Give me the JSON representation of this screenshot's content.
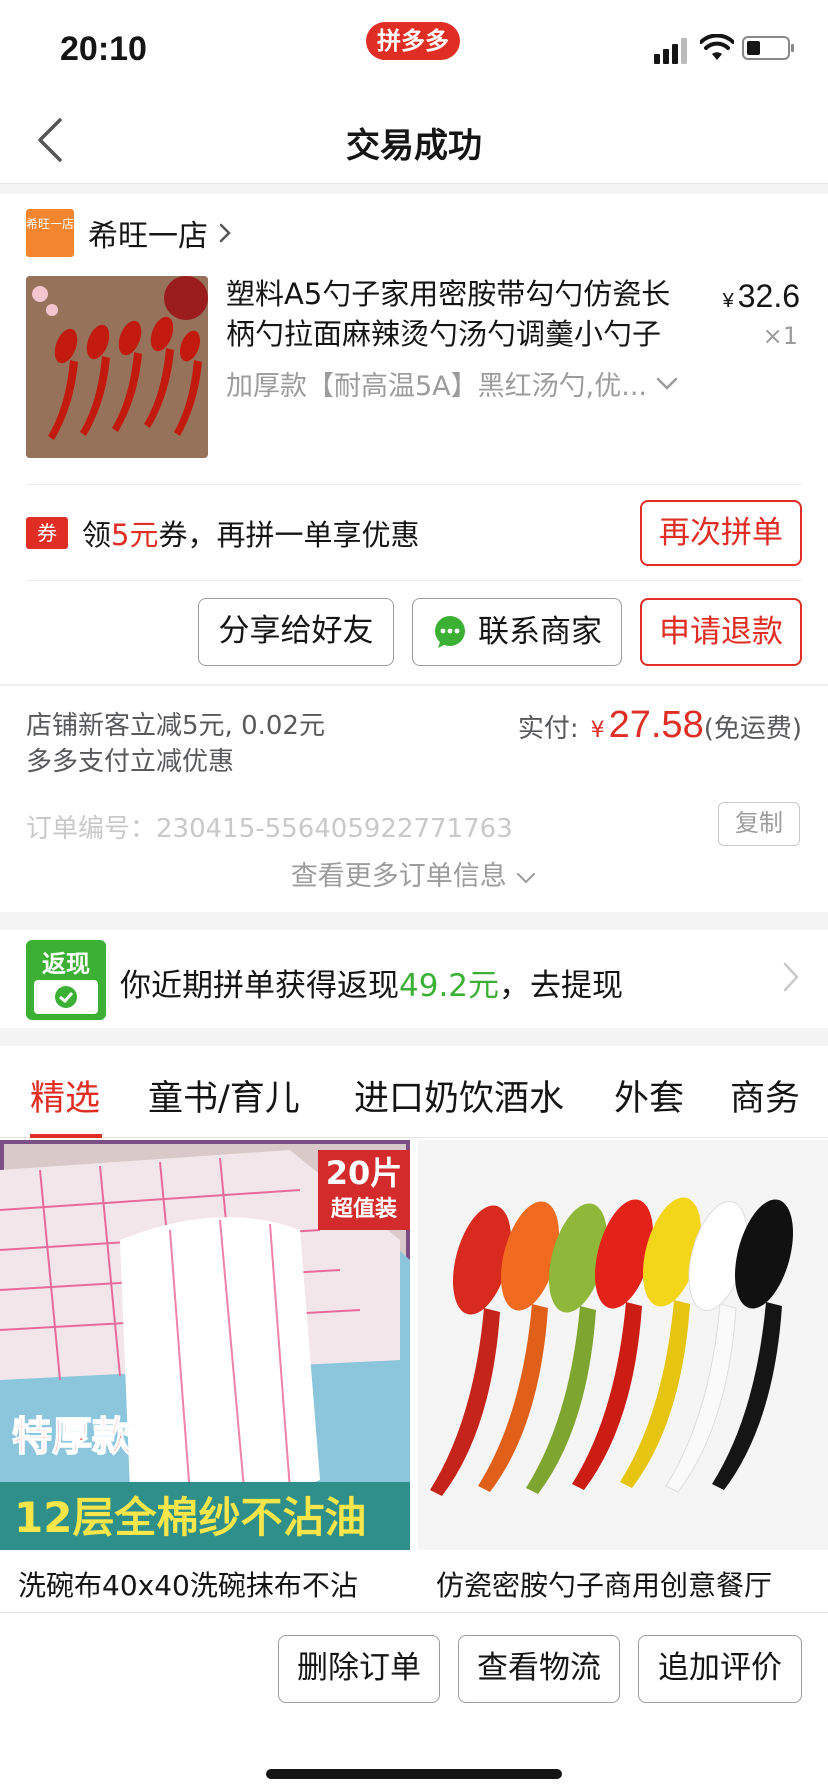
{
  "status_bar": {
    "time": "20:10",
    "app_badge": "拼多多",
    "battery_level": 0.35
  },
  "nav": {
    "title": "交易成功"
  },
  "store": {
    "logo_text": "希旺一店",
    "name": "希旺一店"
  },
  "product": {
    "title": "塑料A5勺子家用密胺带勾勺仿瓷长柄勺拉面麻辣烫勺汤勺调羹小勺子",
    "price_symbol": "¥",
    "price": "32.6",
    "quantity": "×1",
    "sku": "加厚款【耐高温5A】黑红汤勺,优..."
  },
  "coupon": {
    "icon": "券",
    "text_prefix": "领",
    "amount": "5元",
    "text_suffix": "券，再拼一单享优惠",
    "button": "再次拼单"
  },
  "actions": {
    "share": "分享给好友",
    "contact": "联系商家",
    "refund": "申请退款"
  },
  "payment": {
    "discount_line1": "店铺新客立减5元, 0.02元",
    "discount_line2": "多多支付立减优惠",
    "label": "实付:",
    "currency": "¥",
    "amount": "27.58",
    "shipping": "(免运费)",
    "order_number": "订单编号：230415-556405922771763",
    "copy": "复制",
    "more": "查看更多订单信息"
  },
  "cashback": {
    "icon_text": "返现",
    "text_prefix": "你近期拼单获得返现",
    "amount": "49.2元",
    "text_suffix": "，去提现"
  },
  "tabs": [
    "精选",
    "童书/育儿",
    "进口奶饮酒水",
    "外套",
    "商务"
  ],
  "recommendations": [
    {
      "title": "洗碗布40x40洗碗抹布不沾",
      "badge_number": "20片",
      "badge_text": "超值装",
      "tag": "特厚款",
      "banner": "12层全棉纱不沾油"
    },
    {
      "title": "仿瓷密胺勺子商用创意餐厅"
    }
  ],
  "bottom_actions": {
    "delete": "删除订单",
    "logistics": "查看物流",
    "review": "追加评价"
  },
  "colors": {
    "brand_red": "#e02e24",
    "cashback_green": "#3cb035",
    "store_orange": "#f2852e"
  }
}
